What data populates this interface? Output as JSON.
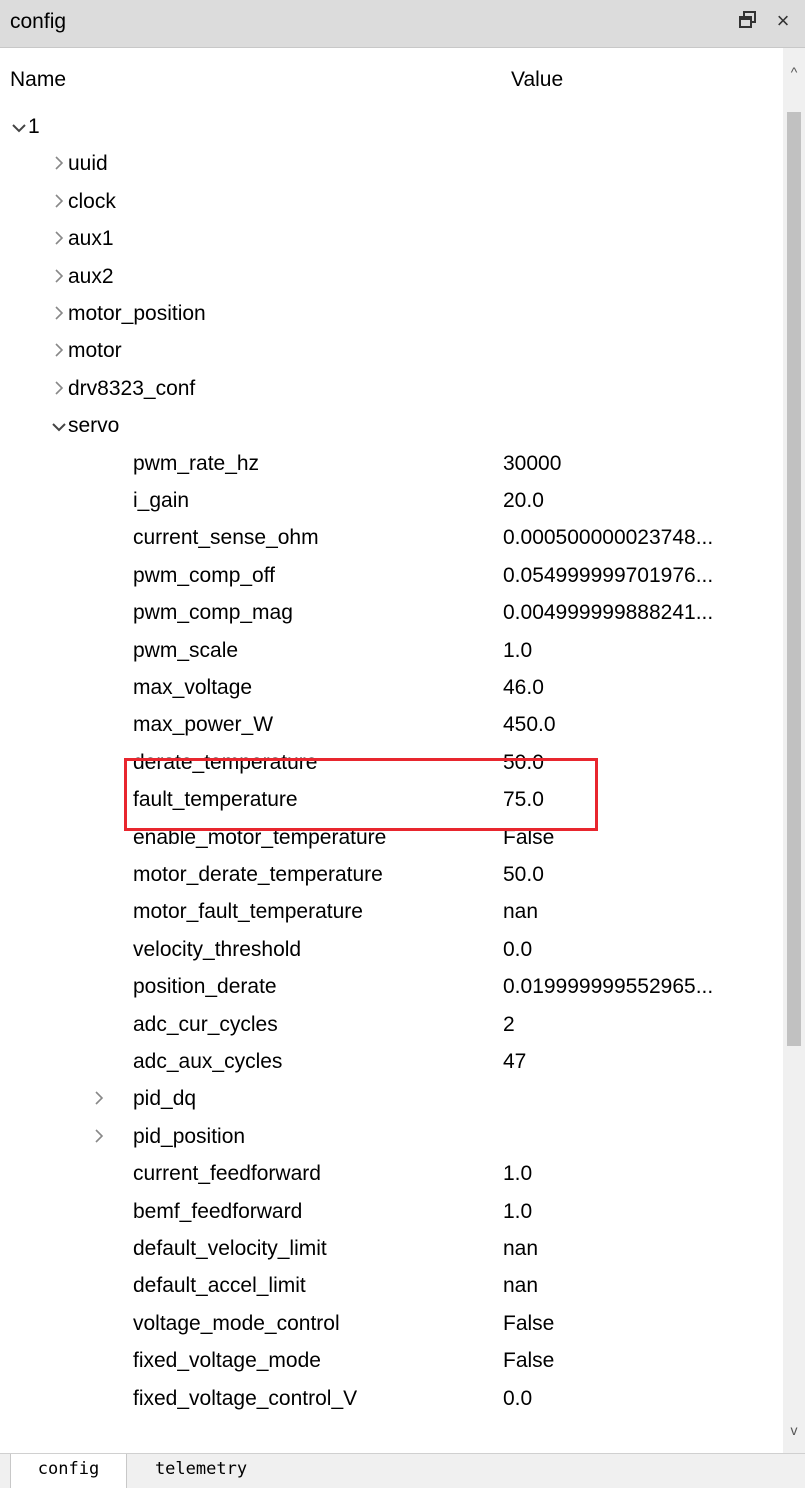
{
  "panel": {
    "title": "config",
    "float_icon": "float-window-icon",
    "close_glyph": "×"
  },
  "columns": {
    "name": "Name",
    "value": "Value"
  },
  "tree": [
    {
      "level": 0,
      "expander": "expanded",
      "name": "1",
      "value": ""
    },
    {
      "level": 1,
      "expander": "collapsed",
      "name": "uuid",
      "value": ""
    },
    {
      "level": 1,
      "expander": "collapsed",
      "name": "clock",
      "value": ""
    },
    {
      "level": 1,
      "expander": "collapsed",
      "name": "aux1",
      "value": ""
    },
    {
      "level": 1,
      "expander": "collapsed",
      "name": "aux2",
      "value": ""
    },
    {
      "level": 1,
      "expander": "collapsed",
      "name": "motor_position",
      "value": ""
    },
    {
      "level": 1,
      "expander": "collapsed",
      "name": "motor",
      "value": ""
    },
    {
      "level": 1,
      "expander": "collapsed",
      "name": "drv8323_conf",
      "value": ""
    },
    {
      "level": 1,
      "expander": "expanded",
      "name": "servo",
      "value": ""
    },
    {
      "level": 2,
      "expander": "none",
      "name": "pwm_rate_hz",
      "value": "30000"
    },
    {
      "level": 2,
      "expander": "none",
      "name": "i_gain",
      "value": "20.0"
    },
    {
      "level": 2,
      "expander": "none",
      "name": "current_sense_ohm",
      "value": "0.000500000023748..."
    },
    {
      "level": 2,
      "expander": "none",
      "name": "pwm_comp_off",
      "value": "0.054999999701976..."
    },
    {
      "level": 2,
      "expander": "none",
      "name": "pwm_comp_mag",
      "value": "0.004999999888241..."
    },
    {
      "level": 2,
      "expander": "none",
      "name": "pwm_scale",
      "value": "1.0"
    },
    {
      "level": 2,
      "expander": "none",
      "name": "max_voltage",
      "value": "46.0"
    },
    {
      "level": 2,
      "expander": "none",
      "name": "max_power_W",
      "value": "450.0"
    },
    {
      "level": 2,
      "expander": "none",
      "name": "derate_temperature",
      "value": "50.0"
    },
    {
      "level": 2,
      "expander": "none",
      "name": "fault_temperature",
      "value": "75.0"
    },
    {
      "level": 2,
      "expander": "none",
      "name": "enable_motor_temperature",
      "value": "False"
    },
    {
      "level": 2,
      "expander": "none",
      "name": "motor_derate_temperature",
      "value": "50.0"
    },
    {
      "level": 2,
      "expander": "none",
      "name": "motor_fault_temperature",
      "value": "nan"
    },
    {
      "level": 2,
      "expander": "none",
      "name": "velocity_threshold",
      "value": "0.0"
    },
    {
      "level": 2,
      "expander": "none",
      "name": "position_derate",
      "value": "0.019999999552965..."
    },
    {
      "level": 2,
      "expander": "none",
      "name": "adc_cur_cycles",
      "value": "2"
    },
    {
      "level": 2,
      "expander": "none",
      "name": "adc_aux_cycles",
      "value": "47"
    },
    {
      "level": 2,
      "expander": "collapsed",
      "name": "pid_dq",
      "value": ""
    },
    {
      "level": 2,
      "expander": "collapsed",
      "name": "pid_position",
      "value": ""
    },
    {
      "level": 2,
      "expander": "none",
      "name": "current_feedforward",
      "value": "1.0"
    },
    {
      "level": 2,
      "expander": "none",
      "name": "bemf_feedforward",
      "value": "1.0"
    },
    {
      "level": 2,
      "expander": "none",
      "name": "default_velocity_limit",
      "value": "nan"
    },
    {
      "level": 2,
      "expander": "none",
      "name": "default_accel_limit",
      "value": "nan"
    },
    {
      "level": 2,
      "expander": "none",
      "name": "voltage_mode_control",
      "value": "False"
    },
    {
      "level": 2,
      "expander": "none",
      "name": "fixed_voltage_mode",
      "value": "False"
    },
    {
      "level": 2,
      "expander": "none",
      "name": "fixed_voltage_control_V",
      "value": "0.0"
    }
  ],
  "highlight": {
    "color": "#e8262e",
    "rows": [
      "derate_temperature",
      "fault_temperature"
    ]
  },
  "scrollbar": {
    "up_glyph": "^",
    "down_glyph": "v"
  },
  "tabs": [
    {
      "label": "config",
      "active": true
    },
    {
      "label": "telemetry",
      "active": false
    }
  ]
}
